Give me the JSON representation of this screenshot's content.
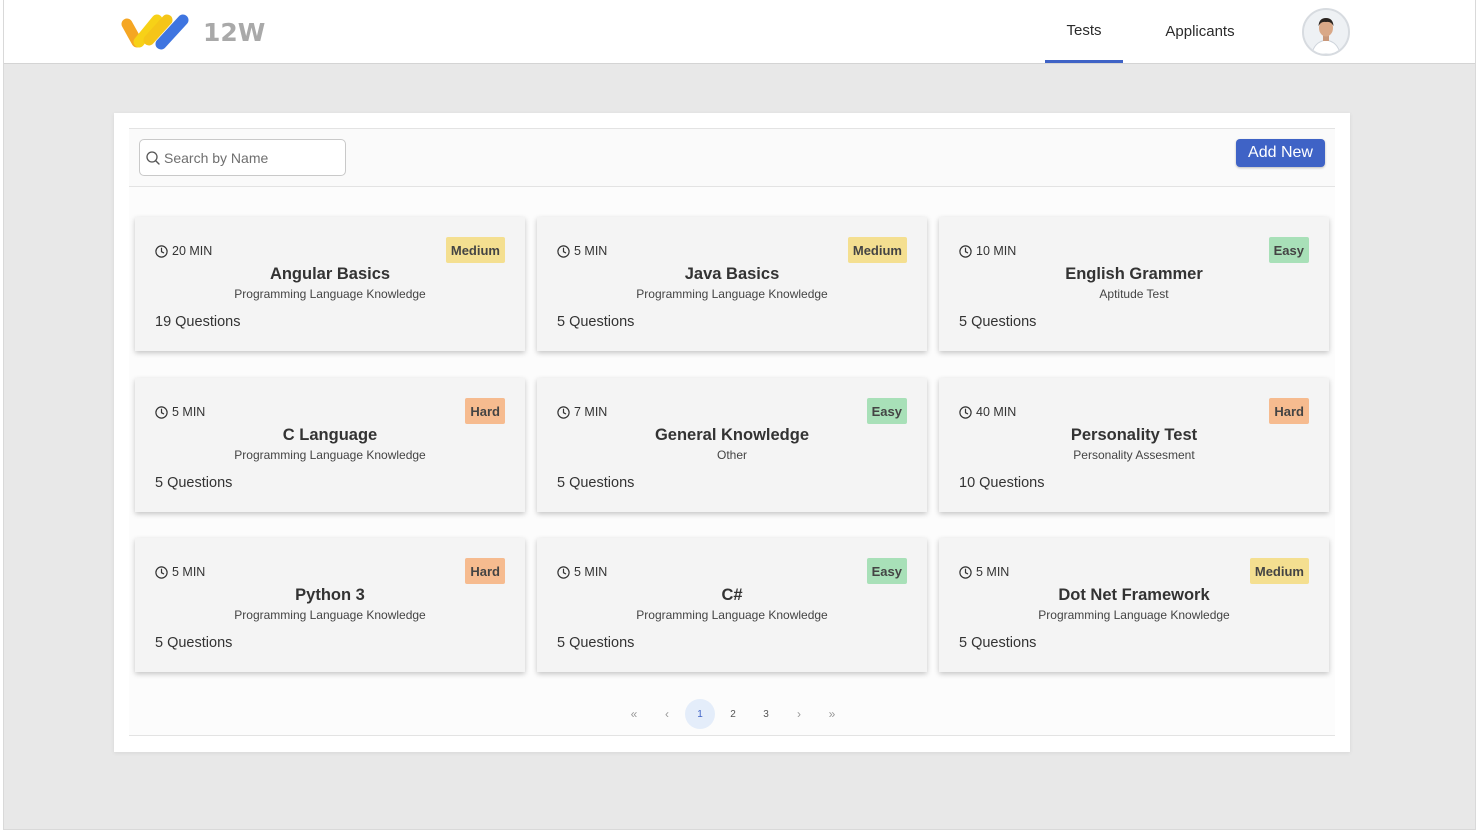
{
  "header": {
    "logo_text": "12W",
    "tabs": [
      {
        "label": "Tests",
        "active": true
      },
      {
        "label": "Applicants",
        "active": false
      }
    ]
  },
  "toolbar": {
    "search_placeholder": "Search by Name",
    "add_label": "Add New"
  },
  "colors": {
    "accent": "#3f63c6",
    "easy": "#a8e0b8",
    "medium": "#f4df90",
    "hard": "#f6bb8f"
  },
  "tests": [
    {
      "duration": "20 MIN",
      "difficulty": "Medium",
      "title": "Angular Basics",
      "category": "Programming Language Knowledge",
      "questions": "19 Questions"
    },
    {
      "duration": "5 MIN",
      "difficulty": "Medium",
      "title": "Java Basics",
      "category": "Programming Language Knowledge",
      "questions": "5 Questions"
    },
    {
      "duration": "10 MIN",
      "difficulty": "Easy",
      "title": "English Grammer",
      "category": "Aptitude Test",
      "questions": "5 Questions"
    },
    {
      "duration": "5 MIN",
      "difficulty": "Hard",
      "title": "C Language",
      "category": "Programming Language Knowledge",
      "questions": "5 Questions"
    },
    {
      "duration": "7 MIN",
      "difficulty": "Easy",
      "title": "General Knowledge",
      "category": "Other",
      "questions": "5 Questions"
    },
    {
      "duration": "40 MIN",
      "difficulty": "Hard",
      "title": "Personality Test",
      "category": "Personality Assesment",
      "questions": "10 Questions"
    },
    {
      "duration": "5 MIN",
      "difficulty": "Hard",
      "title": "Python 3",
      "category": "Programming Language Knowledge",
      "questions": "5 Questions"
    },
    {
      "duration": "5 MIN",
      "difficulty": "Easy",
      "title": "C#",
      "category": "Programming Language Knowledge",
      "questions": "5 Questions"
    },
    {
      "duration": "5 MIN",
      "difficulty": "Medium",
      "title": "Dot Net Framework",
      "category": "Programming Language Knowledge",
      "questions": "5 Questions"
    }
  ],
  "pagination": {
    "first": "«",
    "prev": "‹",
    "pages": [
      "1",
      "2",
      "3"
    ],
    "current": "1",
    "next": "›",
    "last": "»"
  }
}
